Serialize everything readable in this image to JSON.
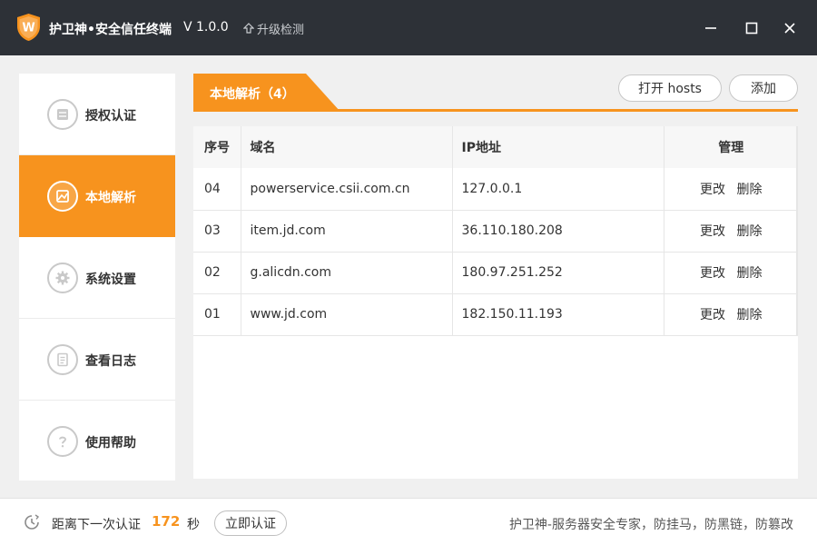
{
  "app": {
    "title": "护卫神•安全信任终端",
    "version": "V 1.0.0",
    "upgrade_label": "升级检测",
    "logo_letter": "W"
  },
  "colors": {
    "accent": "#f7931e",
    "titlebar": "#2d3137"
  },
  "sidebar": {
    "items": [
      {
        "label": "授权认证",
        "icon": "list-icon",
        "active": false
      },
      {
        "label": "本地解析",
        "icon": "image-icon",
        "active": true
      },
      {
        "label": "系统设置",
        "icon": "gear-icon",
        "active": false
      },
      {
        "label": "查看日志",
        "icon": "document-icon",
        "active": false
      },
      {
        "label": "使用帮助",
        "icon": "question-icon",
        "active": false
      }
    ]
  },
  "main": {
    "tab_label": "本地解析（4）",
    "open_hosts_label": "打开 hosts",
    "add_label": "添加",
    "table": {
      "headers": [
        "序号",
        "域名",
        "IP地址",
        "管理"
      ],
      "rows": [
        {
          "no": "04",
          "domain": "powerservice.csii.com.cn",
          "ip": "127.0.0.1",
          "edit": "更改",
          "delete": "删除"
        },
        {
          "no": "03",
          "domain": "item.jd.com",
          "ip": "36.110.180.208",
          "edit": "更改",
          "delete": "删除"
        },
        {
          "no": "02",
          "domain": "g.alicdn.com",
          "ip": "180.97.251.252",
          "edit": "更改",
          "delete": "删除"
        },
        {
          "no": "01",
          "domain": "www.jd.com",
          "ip": "182.150.11.193",
          "edit": "更改",
          "delete": "删除"
        }
      ]
    }
  },
  "footer": {
    "countdown_prefix": "距离下一次认证",
    "countdown_value": "172",
    "countdown_unit": "秒",
    "auth_button": "立即认证",
    "slogan": "护卫神-服务器安全专家，防挂马，防黑链，防篡改"
  }
}
